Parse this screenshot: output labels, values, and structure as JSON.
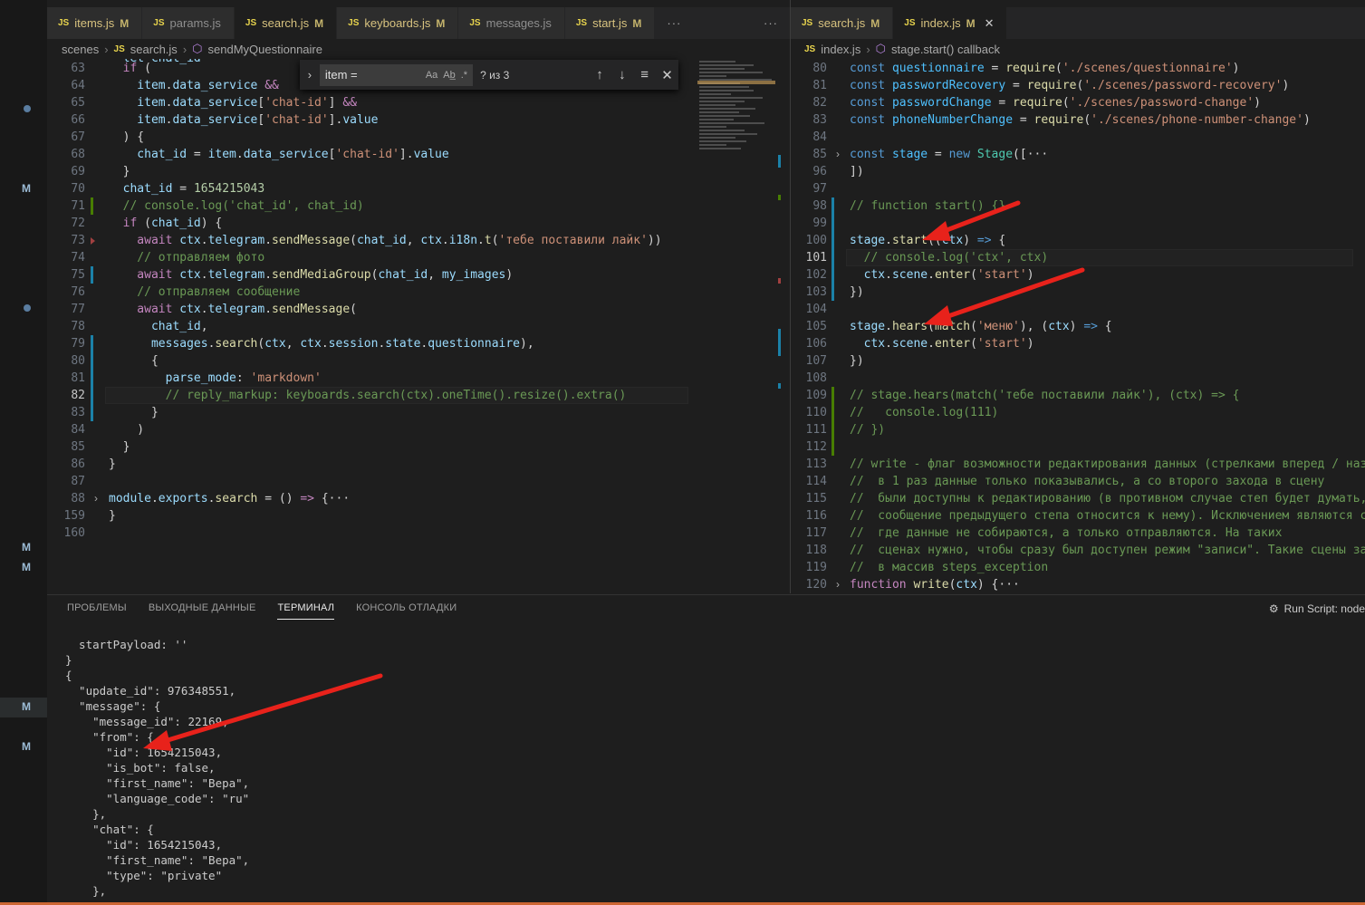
{
  "activity": {
    "markers": [
      "M",
      "M",
      "M",
      "M",
      "M"
    ]
  },
  "left_tabs": [
    {
      "name": "items.js",
      "mod": "M",
      "modified": true
    },
    {
      "name": "params.js",
      "mod": "",
      "modified": false
    },
    {
      "name": "search.js",
      "mod": "M",
      "modified": true,
      "active": true
    },
    {
      "name": "keyboards.js",
      "mod": "M",
      "modified": true
    },
    {
      "name": "messages.js",
      "mod": "",
      "modified": false
    },
    {
      "name": "start.js",
      "mod": "M",
      "modified": true
    }
  ],
  "right_tabs": [
    {
      "name": "search.js",
      "mod": "M",
      "modified": true
    },
    {
      "name": "index.js",
      "mod": "M",
      "modified": true,
      "active": true,
      "close": "✕"
    }
  ],
  "icons": {
    "js": "JS",
    "more": "···",
    "chevron": "›"
  },
  "left_crumbs": {
    "folder": "scenes",
    "file": "search.js",
    "symbol": "sendMyQuestionnaire"
  },
  "right_crumbs": {
    "file": "index.js",
    "symbol": "stage.start() callback"
  },
  "find": {
    "value": "item =",
    "case": "Aa",
    "word": "Ab̲",
    "regex": ".*",
    "count": "? из 3",
    "up": "↑",
    "down": "↓",
    "menu": "≡",
    "close": "✕",
    "expand": "›"
  },
  "left_code": [
    {
      "n": "63",
      "t": [
        [
          "k",
          "  if"
        ],
        [
          "p",
          " ("
        ]
      ]
    },
    {
      "n": "64",
      "t": [
        [
          "v",
          "    item"
        ],
        [
          "p",
          "."
        ],
        [
          "v",
          "data_service"
        ],
        [
          "p",
          " "
        ],
        [
          "k",
          "&&"
        ]
      ]
    },
    {
      "n": "65",
      "t": [
        [
          "v",
          "    item"
        ],
        [
          "p",
          "."
        ],
        [
          "v",
          "data_service"
        ],
        [
          "p",
          "["
        ],
        [
          "s",
          "'chat-id'"
        ],
        [
          "p",
          "] "
        ],
        [
          "k",
          "&&"
        ]
      ],
      "dot": true
    },
    {
      "n": "66",
      "t": [
        [
          "v",
          "    item"
        ],
        [
          "p",
          "."
        ],
        [
          "v",
          "data_service"
        ],
        [
          "p",
          "["
        ],
        [
          "s",
          "'chat-id'"
        ],
        [
          "p",
          "]."
        ],
        [
          "v",
          "value"
        ]
      ]
    },
    {
      "n": "67",
      "t": [
        [
          "p",
          "  ) {"
        ]
      ]
    },
    {
      "n": "68",
      "t": [
        [
          "v",
          "    chat_id"
        ],
        [
          "p",
          " = "
        ],
        [
          "v",
          "item"
        ],
        [
          "p",
          "."
        ],
        [
          "v",
          "data_service"
        ],
        [
          "p",
          "["
        ],
        [
          "s",
          "'chat-id'"
        ],
        [
          "p",
          "]."
        ],
        [
          "v",
          "value"
        ]
      ]
    },
    {
      "n": "69",
      "t": [
        [
          "p",
          "  }"
        ]
      ]
    },
    {
      "n": "70",
      "t": [
        [
          "v",
          "  chat_id"
        ],
        [
          "p",
          " = "
        ],
        [
          "u",
          "1654215043"
        ]
      ]
    },
    {
      "n": "71",
      "t": [
        [
          "c",
          "  // console.log('chat_id', chat_id)"
        ]
      ],
      "bar": "#487e02"
    },
    {
      "n": "72",
      "t": [
        [
          "k",
          "  if"
        ],
        [
          "p",
          " ("
        ],
        [
          "v",
          "chat_id"
        ],
        [
          "p",
          ") {"
        ]
      ]
    },
    {
      "n": "73",
      "t": [
        [
          "k",
          "    await "
        ],
        [
          "v",
          "ctx"
        ],
        [
          "p",
          "."
        ],
        [
          "v",
          "telegram"
        ],
        [
          "p",
          "."
        ],
        [
          "f",
          "sendMessage"
        ],
        [
          "p",
          "("
        ],
        [
          "v",
          "chat_id"
        ],
        [
          "p",
          ", "
        ],
        [
          "v",
          "ctx"
        ],
        [
          "p",
          "."
        ],
        [
          "v",
          "i18n"
        ],
        [
          "p",
          "."
        ],
        [
          "f",
          "t"
        ],
        [
          "p",
          "("
        ],
        [
          "s",
          "'тебе поставили лайк'"
        ],
        [
          "p",
          "))"
        ]
      ],
      "tri": true
    },
    {
      "n": "74",
      "t": [
        [
          "c",
          "    // отправляем фото"
        ]
      ]
    },
    {
      "n": "75",
      "t": [
        [
          "k",
          "    await "
        ],
        [
          "v",
          "ctx"
        ],
        [
          "p",
          "."
        ],
        [
          "v",
          "telegram"
        ],
        [
          "p",
          "."
        ],
        [
          "f",
          "sendMediaGroup"
        ],
        [
          "p",
          "("
        ],
        [
          "v",
          "chat_id"
        ],
        [
          "p",
          ", "
        ],
        [
          "v",
          "my_images"
        ],
        [
          "p",
          ")"
        ]
      ],
      "bar": "#1b81a8"
    },
    {
      "n": "76",
      "t": [
        [
          "c",
          "    // отправляем сообщение"
        ]
      ]
    },
    {
      "n": "77",
      "t": [
        [
          "k",
          "    await "
        ],
        [
          "v",
          "ctx"
        ],
        [
          "p",
          "."
        ],
        [
          "v",
          "telegram"
        ],
        [
          "p",
          "."
        ],
        [
          "f",
          "sendMessage"
        ],
        [
          "p",
          "("
        ]
      ]
    },
    {
      "n": "78",
      "t": [
        [
          "v",
          "      chat_id"
        ],
        [
          "p",
          ","
        ]
      ]
    },
    {
      "n": "79",
      "t": [
        [
          "v",
          "      messages"
        ],
        [
          "p",
          "."
        ],
        [
          "f",
          "search"
        ],
        [
          "p",
          "("
        ],
        [
          "v",
          "ctx"
        ],
        [
          "p",
          ", "
        ],
        [
          "v",
          "ctx"
        ],
        [
          "p",
          "."
        ],
        [
          "v",
          "session"
        ],
        [
          "p",
          "."
        ],
        [
          "v",
          "state"
        ],
        [
          "p",
          "."
        ],
        [
          "v",
          "questionnaire"
        ],
        [
          "p",
          "),"
        ]
      ],
      "bar": "#1b81a8"
    },
    {
      "n": "80",
      "t": [
        [
          "p",
          "      {"
        ]
      ],
      "bar": "#1b81a8"
    },
    {
      "n": "81",
      "t": [
        [
          "v",
          "        parse_mode"
        ],
        [
          "p",
          ": "
        ],
        [
          "s",
          "'markdown'"
        ]
      ],
      "bar": "#1b81a8"
    },
    {
      "n": "82",
      "t": [
        [
          "c",
          "        // reply_markup: keyboards.search(ctx).oneTime().resize().extra()"
        ]
      ],
      "bar": "#1b81a8",
      "cur": true
    },
    {
      "n": "83",
      "t": [
        [
          "p",
          "      }"
        ]
      ],
      "bar": "#1b81a8"
    },
    {
      "n": "84",
      "t": [
        [
          "p",
          "    )"
        ]
      ]
    },
    {
      "n": "85",
      "t": [
        [
          "p",
          "  }"
        ]
      ]
    },
    {
      "n": "86",
      "t": [
        [
          "p",
          "}"
        ]
      ]
    },
    {
      "n": "87",
      "t": []
    },
    {
      "n": "88",
      "t": [
        [
          "v",
          "module"
        ],
        [
          "p",
          "."
        ],
        [
          "v",
          "exports"
        ],
        [
          "p",
          "."
        ],
        [
          "f",
          "search"
        ],
        [
          "p",
          " = () "
        ],
        [
          "k",
          "=>"
        ],
        [
          "p",
          " {···"
        ]
      ],
      "fold": true
    },
    {
      "n": "159",
      "t": [
        [
          "p",
          "}"
        ]
      ]
    },
    {
      "n": "160",
      "t": []
    }
  ],
  "right_code": [
    {
      "n": "80",
      "t": [
        [
          "b",
          "const "
        ],
        [
          "t",
          "questionnaire"
        ],
        [
          "p",
          " = "
        ],
        [
          "f",
          "require"
        ],
        [
          "p",
          "("
        ],
        [
          "s",
          "'./scenes/questionnaire'"
        ],
        [
          "p",
          ")"
        ]
      ]
    },
    {
      "n": "81",
      "t": [
        [
          "b",
          "const "
        ],
        [
          "t",
          "passwordRecovery"
        ],
        [
          "p",
          " = "
        ],
        [
          "f",
          "require"
        ],
        [
          "p",
          "("
        ],
        [
          "s",
          "'./scenes/password-recovery'"
        ],
        [
          "p",
          ")"
        ]
      ]
    },
    {
      "n": "82",
      "t": [
        [
          "b",
          "const "
        ],
        [
          "t",
          "passwordChange"
        ],
        [
          "p",
          " = "
        ],
        [
          "f",
          "require"
        ],
        [
          "p",
          "("
        ],
        [
          "s",
          "'./scenes/password-change'"
        ],
        [
          "p",
          ")"
        ]
      ]
    },
    {
      "n": "83",
      "t": [
        [
          "b",
          "const "
        ],
        [
          "t",
          "phoneNumberChange"
        ],
        [
          "p",
          " = "
        ],
        [
          "f",
          "require"
        ],
        [
          "p",
          "("
        ],
        [
          "s",
          "'./scenes/phone-number-change'"
        ],
        [
          "p",
          ")"
        ]
      ]
    },
    {
      "n": "84",
      "t": []
    },
    {
      "n": "85",
      "t": [
        [
          "b",
          "const "
        ],
        [
          "t",
          "stage"
        ],
        [
          "p",
          " = "
        ],
        [
          "b",
          "new "
        ],
        [
          "y",
          "Stage"
        ],
        [
          "p",
          "([···"
        ]
      ],
      "fold": true
    },
    {
      "n": "96",
      "t": [
        [
          "p",
          "])"
        ]
      ]
    },
    {
      "n": "97",
      "t": []
    },
    {
      "n": "98",
      "t": [
        [
          "c",
          "// function start() {}"
        ]
      ],
      "bar": "#1b81a8"
    },
    {
      "n": "99",
      "t": [],
      "bar": "#1b81a8"
    },
    {
      "n": "100",
      "t": [
        [
          "v",
          "stage"
        ],
        [
          "p",
          "."
        ],
        [
          "f",
          "start"
        ],
        [
          "p",
          "(("
        ],
        [
          "v",
          "ctx"
        ],
        [
          "p",
          ") "
        ],
        [
          "b",
          "=>"
        ],
        [
          "p",
          " {"
        ]
      ],
      "bar": "#1b81a8"
    },
    {
      "n": "101",
      "t": [
        [
          "c",
          "  // console.log('ctx', ctx)"
        ]
      ],
      "bar": "#1b81a8",
      "cur": true
    },
    {
      "n": "102",
      "t": [
        [
          "v",
          "  ctx"
        ],
        [
          "p",
          "."
        ],
        [
          "v",
          "scene"
        ],
        [
          "p",
          "."
        ],
        [
          "f",
          "enter"
        ],
        [
          "p",
          "("
        ],
        [
          "s",
          "'start'"
        ],
        [
          "p",
          ")"
        ]
      ],
      "bar": "#1b81a8"
    },
    {
      "n": "103",
      "t": [
        [
          "p",
          "})"
        ]
      ],
      "bar": "#1b81a8"
    },
    {
      "n": "104",
      "t": []
    },
    {
      "n": "105",
      "t": [
        [
          "v",
          "stage"
        ],
        [
          "p",
          "."
        ],
        [
          "f",
          "hears"
        ],
        [
          "p",
          "("
        ],
        [
          "f",
          "match"
        ],
        [
          "p",
          "("
        ],
        [
          "s",
          "'меню'"
        ],
        [
          "p",
          "), ("
        ],
        [
          "v",
          "ctx"
        ],
        [
          "p",
          ") "
        ],
        [
          "b",
          "=>"
        ],
        [
          "p",
          " {"
        ]
      ]
    },
    {
      "n": "106",
      "t": [
        [
          "v",
          "  ctx"
        ],
        [
          "p",
          "."
        ],
        [
          "v",
          "scene"
        ],
        [
          "p",
          "."
        ],
        [
          "f",
          "enter"
        ],
        [
          "p",
          "("
        ],
        [
          "s",
          "'start'"
        ],
        [
          "p",
          ")"
        ]
      ]
    },
    {
      "n": "107",
      "t": [
        [
          "p",
          "})"
        ]
      ]
    },
    {
      "n": "108",
      "t": []
    },
    {
      "n": "109",
      "t": [
        [
          "c",
          "// stage.hears(match('тебе поставили лайк'), (ctx) => {"
        ]
      ],
      "bar": "#487e02"
    },
    {
      "n": "110",
      "t": [
        [
          "c",
          "//   console.log(111)"
        ]
      ],
      "bar": "#487e02"
    },
    {
      "n": "111",
      "t": [
        [
          "c",
          "// })"
        ]
      ],
      "bar": "#487e02"
    },
    {
      "n": "112",
      "t": [],
      "bar": "#487e02"
    },
    {
      "n": "113",
      "t": [
        [
          "c",
          "// write - флаг возможности редактирования данных (стрелками вперед / наза"
        ]
      ]
    },
    {
      "n": "114",
      "t": [
        [
          "c",
          "//  в 1 раз данные только показывались, а со второго захода в сцену"
        ]
      ]
    },
    {
      "n": "115",
      "t": [
        [
          "c",
          "//  были доступны к редактированию (в противном случае степ будет думать,"
        ]
      ]
    },
    {
      "n": "116",
      "t": [
        [
          "c",
          "//  сообщение предыдущего степа относится к нему). Исключением являются ст"
        ]
      ]
    },
    {
      "n": "117",
      "t": [
        [
          "c",
          "//  где данные не собираются, а только отправляются. На таких"
        ]
      ]
    },
    {
      "n": "118",
      "t": [
        [
          "c",
          "//  сценах нужно, чтобы сразу был доступен режим \"записи\". Такие сцены зан"
        ]
      ]
    },
    {
      "n": "119",
      "t": [
        [
          "c",
          "//  в массив steps_exception"
        ]
      ]
    },
    {
      "n": "120",
      "t": [
        [
          "k",
          "function "
        ],
        [
          "f",
          "write"
        ],
        [
          "p",
          "("
        ],
        [
          "v",
          "ctx"
        ],
        [
          "p",
          ") {···"
        ]
      ],
      "fold": true
    }
  ],
  "panel": {
    "tabs": [
      "ПРОБЛЕМЫ",
      "ВЫХОДНЫЕ ДАННЫЕ",
      "ТЕРМИНАЛ",
      "КОНСОЛЬ ОТЛАДКИ"
    ],
    "active_tab": 2,
    "run_script": "Run Script: node",
    "gear": "⚙"
  },
  "terminal_lines": [
    "  startPayload: ''",
    "}",
    "{",
    "  \"update_id\": 976348551,",
    "  \"message\": {",
    "    \"message_id\": 22169,",
    "    \"from\": {",
    "      \"id\": 1654215043,",
    "      \"is_bot\": false,",
    "      \"first_name\": \"Вера\",",
    "      \"language_code\": \"ru\"",
    "    },",
    "    \"chat\": {",
    "      \"id\": 1654215043,",
    "      \"first_name\": \"Вера\",",
    "      \"type\": \"private\"",
    "    },"
  ],
  "colors": {
    "arrow": "#e8221b",
    "accent": "#007acc",
    "status": "#cc6633"
  }
}
